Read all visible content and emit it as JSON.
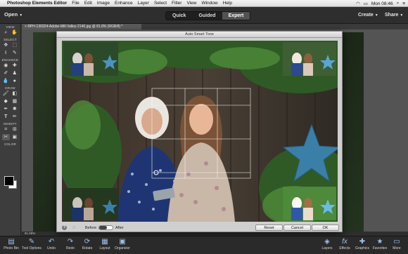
{
  "menubar": {
    "app_name": "Photoshop Elements Editor",
    "items": [
      "File",
      "Edit",
      "Image",
      "Enhance",
      "Layer",
      "Select",
      "Filter",
      "View",
      "Window",
      "Help"
    ],
    "clock": "Mon 08:46"
  },
  "appbar": {
    "open_label": "Open",
    "modes": [
      "Quick",
      "Guided",
      "Expert"
    ],
    "active_mode": "Expert",
    "create_label": "Create",
    "share_label": "Share"
  },
  "toolbox": {
    "sections": [
      "VIEW",
      "SELECT",
      "ENHANCE",
      "DRAW",
      "MODIFY",
      "COLOR"
    ]
  },
  "document": {
    "tab_title": "RPH-130324-Adobe-Mill-Valley-2146.jpg @ 81.8% (RGB/8) *",
    "zoom": "81.59%"
  },
  "dialog": {
    "title": "Auto Smart Tone",
    "before_label": "Before",
    "after_label": "After",
    "reset_label": "Reset",
    "cancel_label": "Cancel",
    "ok_label": "OK"
  },
  "bottombar": {
    "left_items": [
      "Photo Bin",
      "Tool Options",
      "Undo",
      "Redo",
      "Rotate",
      "Layout",
      "Organizer"
    ],
    "right_items": [
      "Layers",
      "Effects",
      "Graphics",
      "Favorites",
      "More"
    ]
  },
  "colors": {
    "accent_blue": "#9ec3ea",
    "star_blue": "#3a7fa8"
  }
}
